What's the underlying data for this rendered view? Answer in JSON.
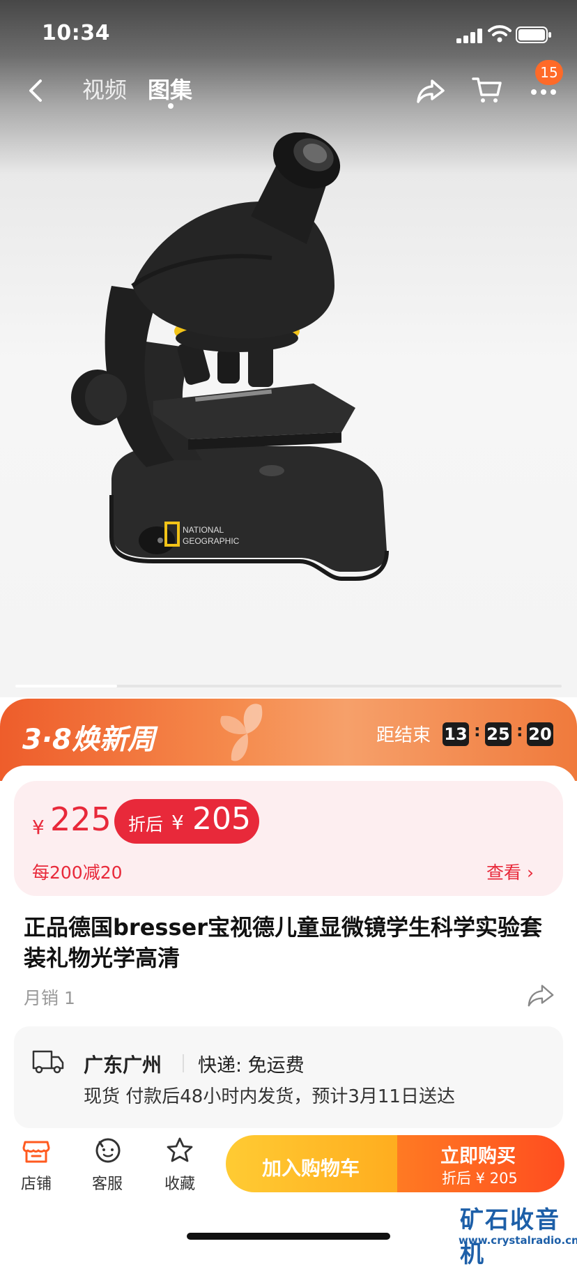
{
  "status_bar": {
    "time": "10:34"
  },
  "top_nav": {
    "tabs": [
      {
        "label": "视频"
      },
      {
        "label": "图集"
      }
    ],
    "active_tab": "图集",
    "more_badge": "15"
  },
  "promo": {
    "title": "3·8焕新周",
    "countdown_label": "距结束",
    "hours": "13",
    "minutes": "25",
    "seconds": "20",
    "separator": ":"
  },
  "price": {
    "currency": "¥",
    "original": "225",
    "after_discount_label": "折后",
    "after_discount": "205",
    "coupon": "每200减20",
    "view_label": "查看 ›"
  },
  "product": {
    "title": "正品德国bresser宝视德儿童显微镜学生科学实验套装礼物光学高清",
    "monthly_sales": "月销 1"
  },
  "shipping": {
    "location": "广东广州",
    "express": "快递: 免运费",
    "delivery_note": "现货 付款后48小时内发货，预计3月11日送达"
  },
  "bottom_bar": {
    "store_label": "店铺",
    "service_label": "客服",
    "favorite_label": "收藏",
    "add_to_cart_label": "加入购物车",
    "buy_now_label": "立即购买",
    "buy_now_sub": "折后 ¥ 205"
  },
  "image_logo_text": "NATIONAL GEOGRAPHIC",
  "watermark": {
    "name": "矿石收音机",
    "url": "www.crystalradio.cn"
  },
  "colors": {
    "accent_red": "#e8293a",
    "promo_orange": "#ee5d2b",
    "cart_yellow": "#ffbd2a",
    "buy_orange": "#ff5a1f"
  }
}
